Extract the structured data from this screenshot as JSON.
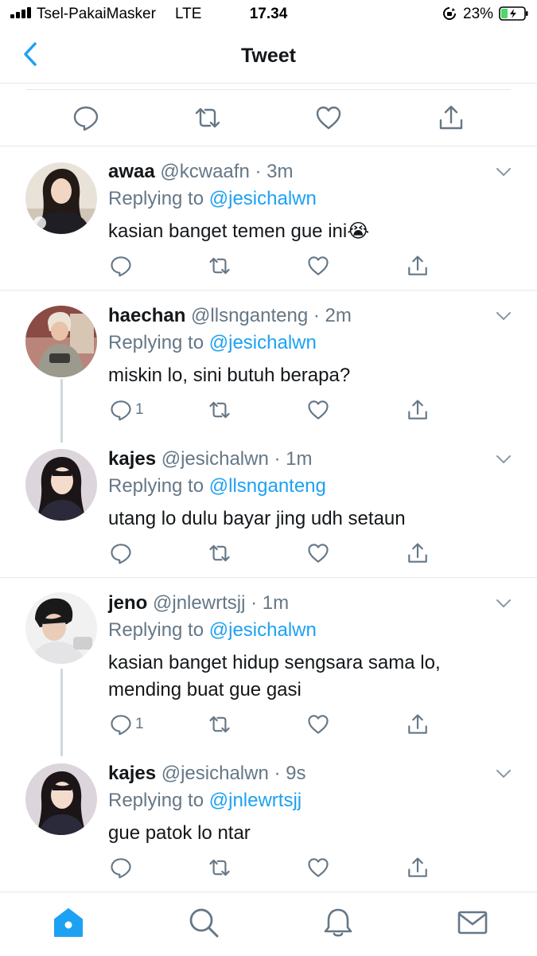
{
  "status_bar": {
    "carrier": "Tsel-PakaiMasker",
    "network": "LTE",
    "time": "17.34",
    "battery": "23%"
  },
  "nav": {
    "title": "Tweet"
  },
  "colors": {
    "accent": "#1da1f2",
    "secondary_text": "#657786",
    "divider": "#e1e8ed"
  },
  "replies": [
    {
      "name": "awaa",
      "handle": "@kcwaafn",
      "time": "3m",
      "replying_label": "Replying to",
      "replying_to": "@jesichalwn",
      "text": "kasian banget temen gue ini",
      "emoji": "😭",
      "reply_count": ""
    },
    {
      "name": "haechan",
      "handle": "@llsnganteng",
      "time": "2m",
      "replying_label": "Replying to",
      "replying_to": "@jesichalwn",
      "text": "miskin lo, sini butuh berapa?",
      "reply_count": "1"
    },
    {
      "name": "kajes",
      "handle": "@jesichalwn",
      "time": "1m",
      "replying_label": "Replying to",
      "replying_to": "@llsnganteng",
      "text": "utang lo dulu bayar jing udh setaun",
      "reply_count": ""
    },
    {
      "name": "jeno",
      "handle": "@jnlewrtsjj",
      "time": "1m",
      "replying_label": "Replying to",
      "replying_to": "@jesichalwn",
      "text_line1": "kasian banget hidup sengsara sama lo,",
      "text_line2": "mending buat gue gasi",
      "reply_count": "1"
    },
    {
      "name": "kajes",
      "handle": "@jesichalwn",
      "time": "9s",
      "replying_label": "Replying to",
      "replying_to": "@jnlewrtsjj",
      "text": "gue patok lo ntar",
      "reply_count": ""
    }
  ],
  "tab_bar": {
    "active_tab": "home"
  }
}
